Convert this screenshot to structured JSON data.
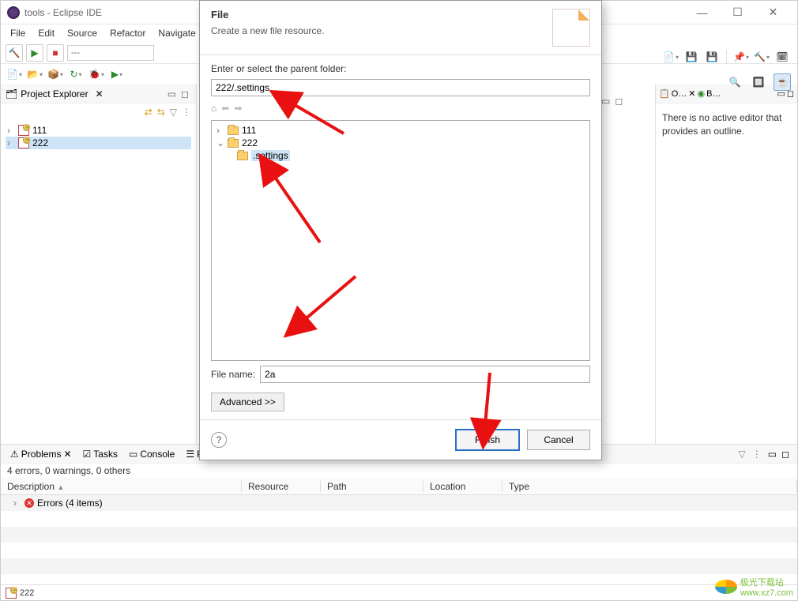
{
  "window": {
    "title": "tools - Eclipse IDE"
  },
  "menubar": [
    "File",
    "Edit",
    "Source",
    "Refactor",
    "Navigate"
  ],
  "toolbar": {
    "text_field": "---"
  },
  "project_explorer": {
    "title": "Project Explorer",
    "items": [
      "111",
      "222"
    ]
  },
  "outline": {
    "tab1": "O…",
    "tab2": "B…",
    "message": "There is no active editor that provides an outline."
  },
  "problems_panel": {
    "tabs": [
      "Problems",
      "Tasks",
      "Console",
      "Properties"
    ],
    "summary": "4 errors, 0 warnings, 0 others",
    "columns": [
      "Description",
      "Resource",
      "Path",
      "Location",
      "Type"
    ],
    "error_group": "Errors (4 items)"
  },
  "statusbar": {
    "project": "222"
  },
  "dialog": {
    "title": "File",
    "subtitle": "Create a new file resource.",
    "parent_label": "Enter or select the parent folder:",
    "parent_value": "222/.settings",
    "tree": {
      "item1": "111",
      "item2": "222",
      "item2_child": ".settings"
    },
    "filename_label": "File name:",
    "filename_value": "2a",
    "advanced": "Advanced >>",
    "finish": "Finish",
    "cancel": "Cancel"
  },
  "watermark": {
    "text1": "极光下载站",
    "text2": "www.xz7.com"
  }
}
